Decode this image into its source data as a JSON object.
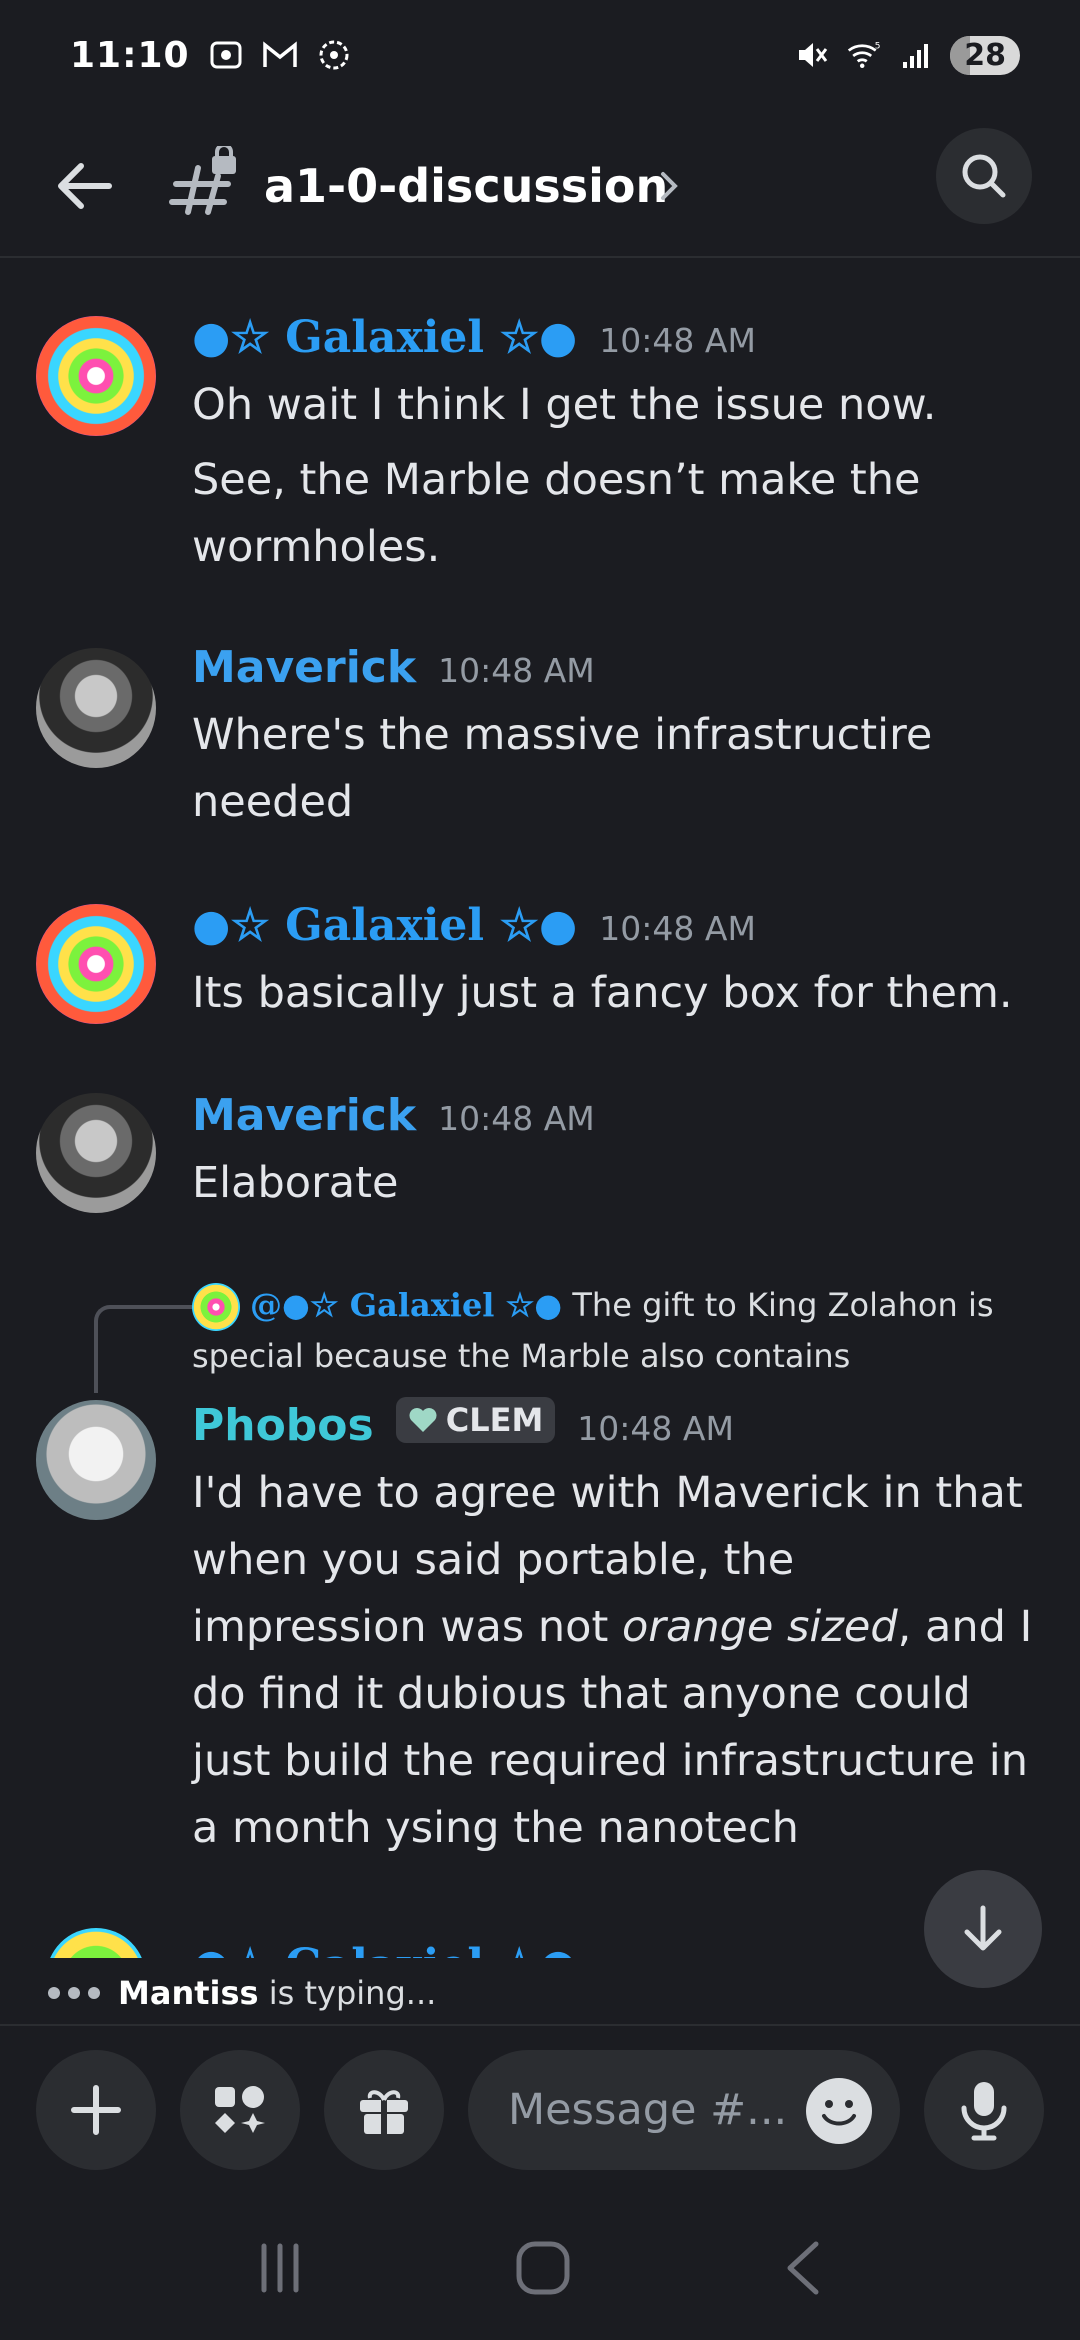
{
  "status_bar": {
    "time": "11:10",
    "battery": "28"
  },
  "header": {
    "channel_name": "a1-0-discussion"
  },
  "messages": [
    {
      "author": "●☆ Galaxiel ☆●",
      "time": "10:48 AM",
      "lines": [
        "Oh wait I think I get the issue now.",
        "See, the Marble doesn’t make the wormholes."
      ]
    },
    {
      "author": "Maverick",
      "time": "10:48 AM",
      "lines": [
        "Where's the massive infrastructire needed"
      ]
    },
    {
      "author": "●☆ Galaxiel ☆●",
      "time": "10:48 AM",
      "lines": [
        "Its basically just a fancy box for them."
      ]
    },
    {
      "author": "Maverick",
      "time": "10:48 AM",
      "lines": [
        "Elaborate"
      ]
    },
    {
      "reply_to": {
        "author": "@●☆ Galaxiel ☆●",
        "text": "The gift to King Zolahon is special because the Marble also contains"
      },
      "author": "Phobos",
      "tag": "CLEM",
      "time": "10:48 AM",
      "text_before": "I'd have to agree with Maverick in that when you said portable, the impression was not ",
      "text_em": "orange sized",
      "text_after": ", and I do find it dubious that anyone could just build the required infrastructure in a month ysing the nanotech"
    }
  ],
  "partial_next_author": "●☆ Galaxiel ☆●",
  "typing": {
    "user": "Mantiss",
    "suffix": " is typing..."
  },
  "composer": {
    "placeholder": "Message #..."
  },
  "colors": {
    "background": "#1b1c21",
    "galaxiel": "#2b9df4",
    "maverick": "#3ba1f0",
    "phobos": "#3fc8d8"
  },
  "icons": [
    "back-arrow-icon",
    "channel-hash-lock-icon",
    "chevron-right-icon",
    "search-icon",
    "arrow-down-icon",
    "plus-icon",
    "apps-icon",
    "gift-icon",
    "emoji-icon",
    "microphone-icon"
  ]
}
